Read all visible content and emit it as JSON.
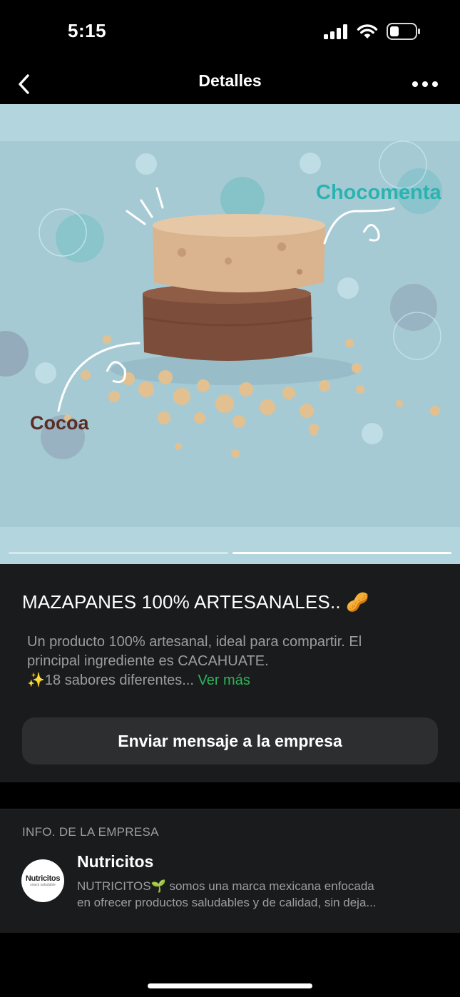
{
  "status_bar": {
    "time": "5:15"
  },
  "nav": {
    "title": "Detalles"
  },
  "media": {
    "label_top": "Chocomenta",
    "label_bottom": "Cocoa",
    "slide_count": 2,
    "active_slide": 2
  },
  "product": {
    "title": "MAZAPANES 100% ARTESANALES.. 🥜",
    "description_line1": "Un producto 100% artesanal, ideal para compartir. El",
    "description_line2": "principal ingrediente es CACAHUATE.",
    "description_line3": "✨18 sabores diferentes...",
    "see_more": "Ver más",
    "message_button": "Enviar mensaje a la empresa"
  },
  "company": {
    "section_label": "INFO. DE LA EMPRESA",
    "logo_text": "Nutricitos",
    "logo_subtext": "snack saludable",
    "name": "Nutricitos",
    "description_line1": "NUTRICITOS🌱 somos una marca mexicana enfocada",
    "description_line2": "en ofrecer productos saludables y de calidad, sin deja..."
  },
  "colors": {
    "background": "#000000",
    "panel": "#1a1b1c",
    "button": "#2c2e30",
    "link": "#2fb35c",
    "secondary_text": "#9b9ea1",
    "media_bg": "#a9cdd6",
    "chocomenta_label": "#2bb3b0",
    "cocoa_label": "#5a2e25"
  },
  "icons": {
    "back": "chevron-left-icon",
    "more": "more-horizontal-icon",
    "signal": "cellular-signal-icon",
    "wifi": "wifi-icon",
    "battery": "battery-icon"
  }
}
